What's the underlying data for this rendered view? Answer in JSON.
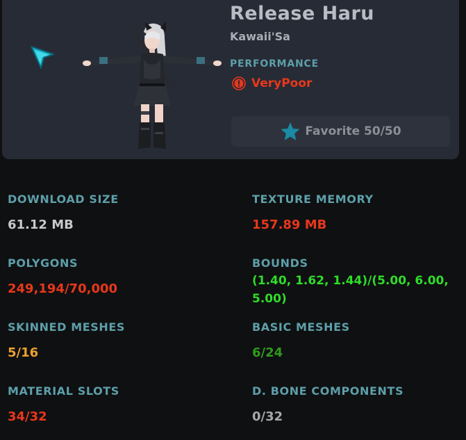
{
  "header": {
    "title": "Release Haru",
    "author": "Kawaii'Sa",
    "performance_label": "PERFORMANCE",
    "performance_value": "VeryPoor",
    "favorite_label": "Favorite 50/50"
  },
  "icons": {
    "cursor": "cursor-arrow-icon",
    "performance": "alert-circle-icon",
    "favorite": "star-icon"
  },
  "stats": {
    "download_size": {
      "label": "DOWNLOAD SIZE",
      "value": "61.12 MB"
    },
    "texture_memory": {
      "label": "TEXTURE MEMORY",
      "value": "157.89 MB"
    },
    "polygons": {
      "label": "POLYGONS",
      "value": "249,194/70,000"
    },
    "bounds": {
      "label": "BOUNDS",
      "value": "(1.40, 1.62, 1.44)/(5.00, 6.00, 5.00)"
    },
    "skinned_meshes": {
      "label": "SKINNED MESHES",
      "value": "5/16"
    },
    "basic_meshes": {
      "label": "BASIC MESHES",
      "value": "6/24"
    },
    "material_slots": {
      "label": "MATERIAL SLOTS",
      "value": "34/32"
    },
    "dynamic_bone_components": {
      "label": "D. BONE COMPONENTS",
      "value": "0/32"
    }
  },
  "colors": {
    "background": "#0f1011",
    "card": "#272b35",
    "label": "#5d9faa",
    "very_poor": "#e8371c",
    "poor": "#eda131",
    "good": "#2f9a1e",
    "excellent": "#2fdc2a",
    "neutral": "#c8c8c8"
  }
}
